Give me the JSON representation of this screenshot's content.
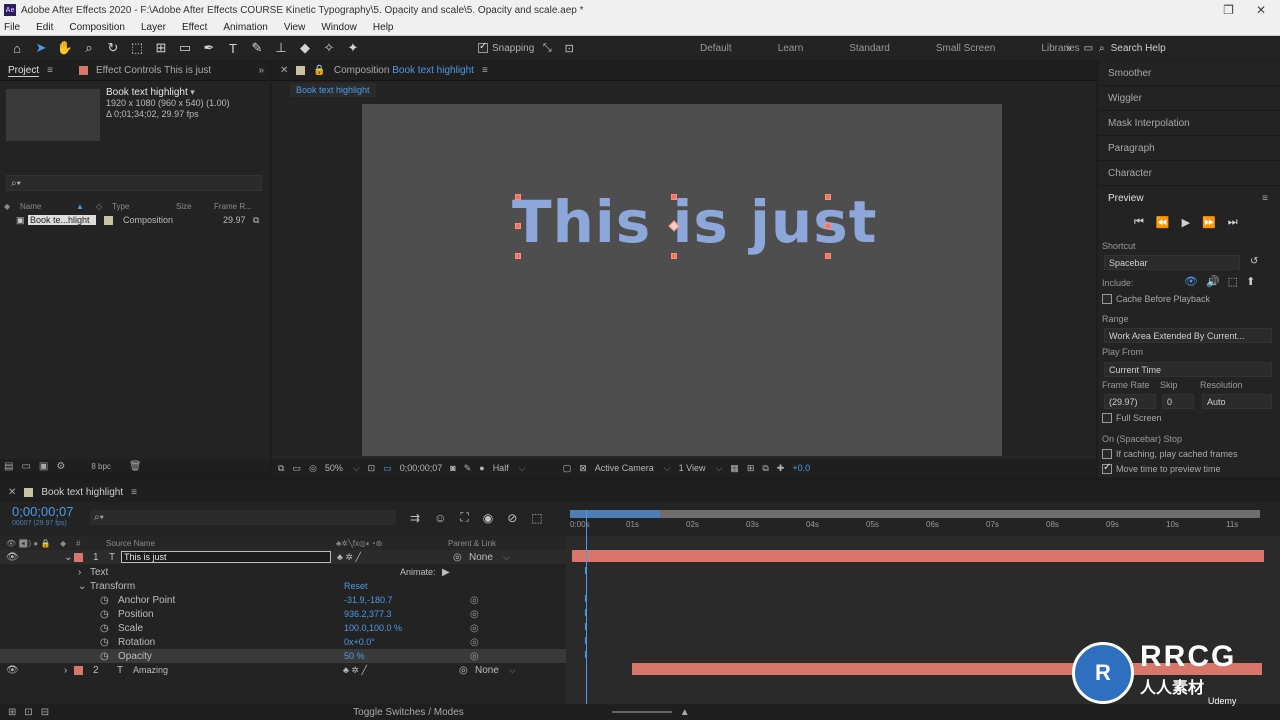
{
  "window": {
    "title": "Adobe After Effects 2020 - F:\\Adobe After Effects COURSE Kinetic Typography\\5. Opacity and scale\\5. Opacity and scale.aep *"
  },
  "menu": [
    "File",
    "Edit",
    "Composition",
    "Layer",
    "Effect",
    "Animation",
    "View",
    "Window",
    "Help"
  ],
  "toolbar": {
    "snapping_label": "Snapping",
    "workspaces": [
      "Default",
      "Learn",
      "Standard",
      "Small Screen",
      "Libraries"
    ],
    "search_help": "Search Help"
  },
  "project_panel": {
    "tab_label": "Project",
    "effect_controls_label": "Effect Controls This is just",
    "item_name": "Book text highlight",
    "item_dims": "1920 x 1080  (960 x 540) (1.00)",
    "item_duration": "Δ 0;01;34;02, 29.97 fps",
    "search_placeholder": "",
    "columns": [
      "Name",
      "Type",
      "Size",
      "Frame R..."
    ],
    "row": {
      "name": "Book te...hlight",
      "type": "Composition",
      "frame_rate": "29.97"
    },
    "bpc": "8 bpc"
  },
  "composition_panel": {
    "tab_prefix": "Composition",
    "tab_name": "Book text highlight",
    "subtab": "Book text highlight",
    "comp_text": "This is just",
    "zoom": "50%",
    "timecode": "0;00;00;07",
    "resolution": "Half",
    "camera": "Active Camera",
    "views": "1 View",
    "exposure": "+0.0"
  },
  "right_panel": {
    "items": [
      "Smoother",
      "Wiggler",
      "Mask Interpolation",
      "Paragraph",
      "Character"
    ],
    "preview_title": "Preview",
    "shortcut_label": "Shortcut",
    "shortcut_value": "Spacebar",
    "include_label": "Include:",
    "cache_label": "Cache Before Playback",
    "range_label": "Range",
    "range_value": "Work Area Extended By Current...",
    "play_from_label": "Play From",
    "play_from_value": "Current Time",
    "frame_rate_label": "Frame Rate",
    "skip_label": "Skip",
    "resolution_label": "Resolution",
    "frame_rate_value": "(29.97)",
    "skip_value": "0",
    "resolution_value": "Auto",
    "full_screen_label": "Full Screen",
    "stop_label": "On (Spacebar) Stop",
    "if_caching_label": "If caching, play cached frames",
    "move_time_label": "Move time to preview time"
  },
  "timeline": {
    "tab_name": "Book text highlight",
    "current_time": "0;00;00;07",
    "fps_line": "00007 (29.97 fps)",
    "ruler_ticks": [
      "0:00s",
      "01s",
      "02s",
      "03s",
      "04s",
      "05s",
      "06s",
      "07s",
      "08s",
      "09s",
      "10s",
      "11s"
    ],
    "col_source_name": "Source Name",
    "col_parent": "Parent & Link",
    "layer1": {
      "num": "1",
      "name": "This is just",
      "parent": "None"
    },
    "text_label": "Text",
    "animate_label": "Animate:",
    "transform_label": "Transform",
    "reset_label": "Reset",
    "props": [
      {
        "name": "Anchor Point",
        "value": "-31.9,-180.7"
      },
      {
        "name": "Position",
        "value": "936.2,377.3"
      },
      {
        "name": "Scale",
        "value": "100.0,100.0 %"
      },
      {
        "name": "Rotation",
        "value": "0x+0.0°"
      },
      {
        "name": "Opacity",
        "value": "50 %"
      }
    ],
    "layer2": {
      "num": "2",
      "name": "Amazing",
      "parent": "None"
    },
    "toggle_label": "Toggle Switches / Modes"
  },
  "watermark": {
    "logo_text": "RRCG",
    "logo_sub": "人人素材",
    "udemy": "Udemy"
  },
  "colors": {
    "accent": "#4d9be6",
    "layer_label": "#d8766b",
    "comp_text": "#8ea7db"
  }
}
